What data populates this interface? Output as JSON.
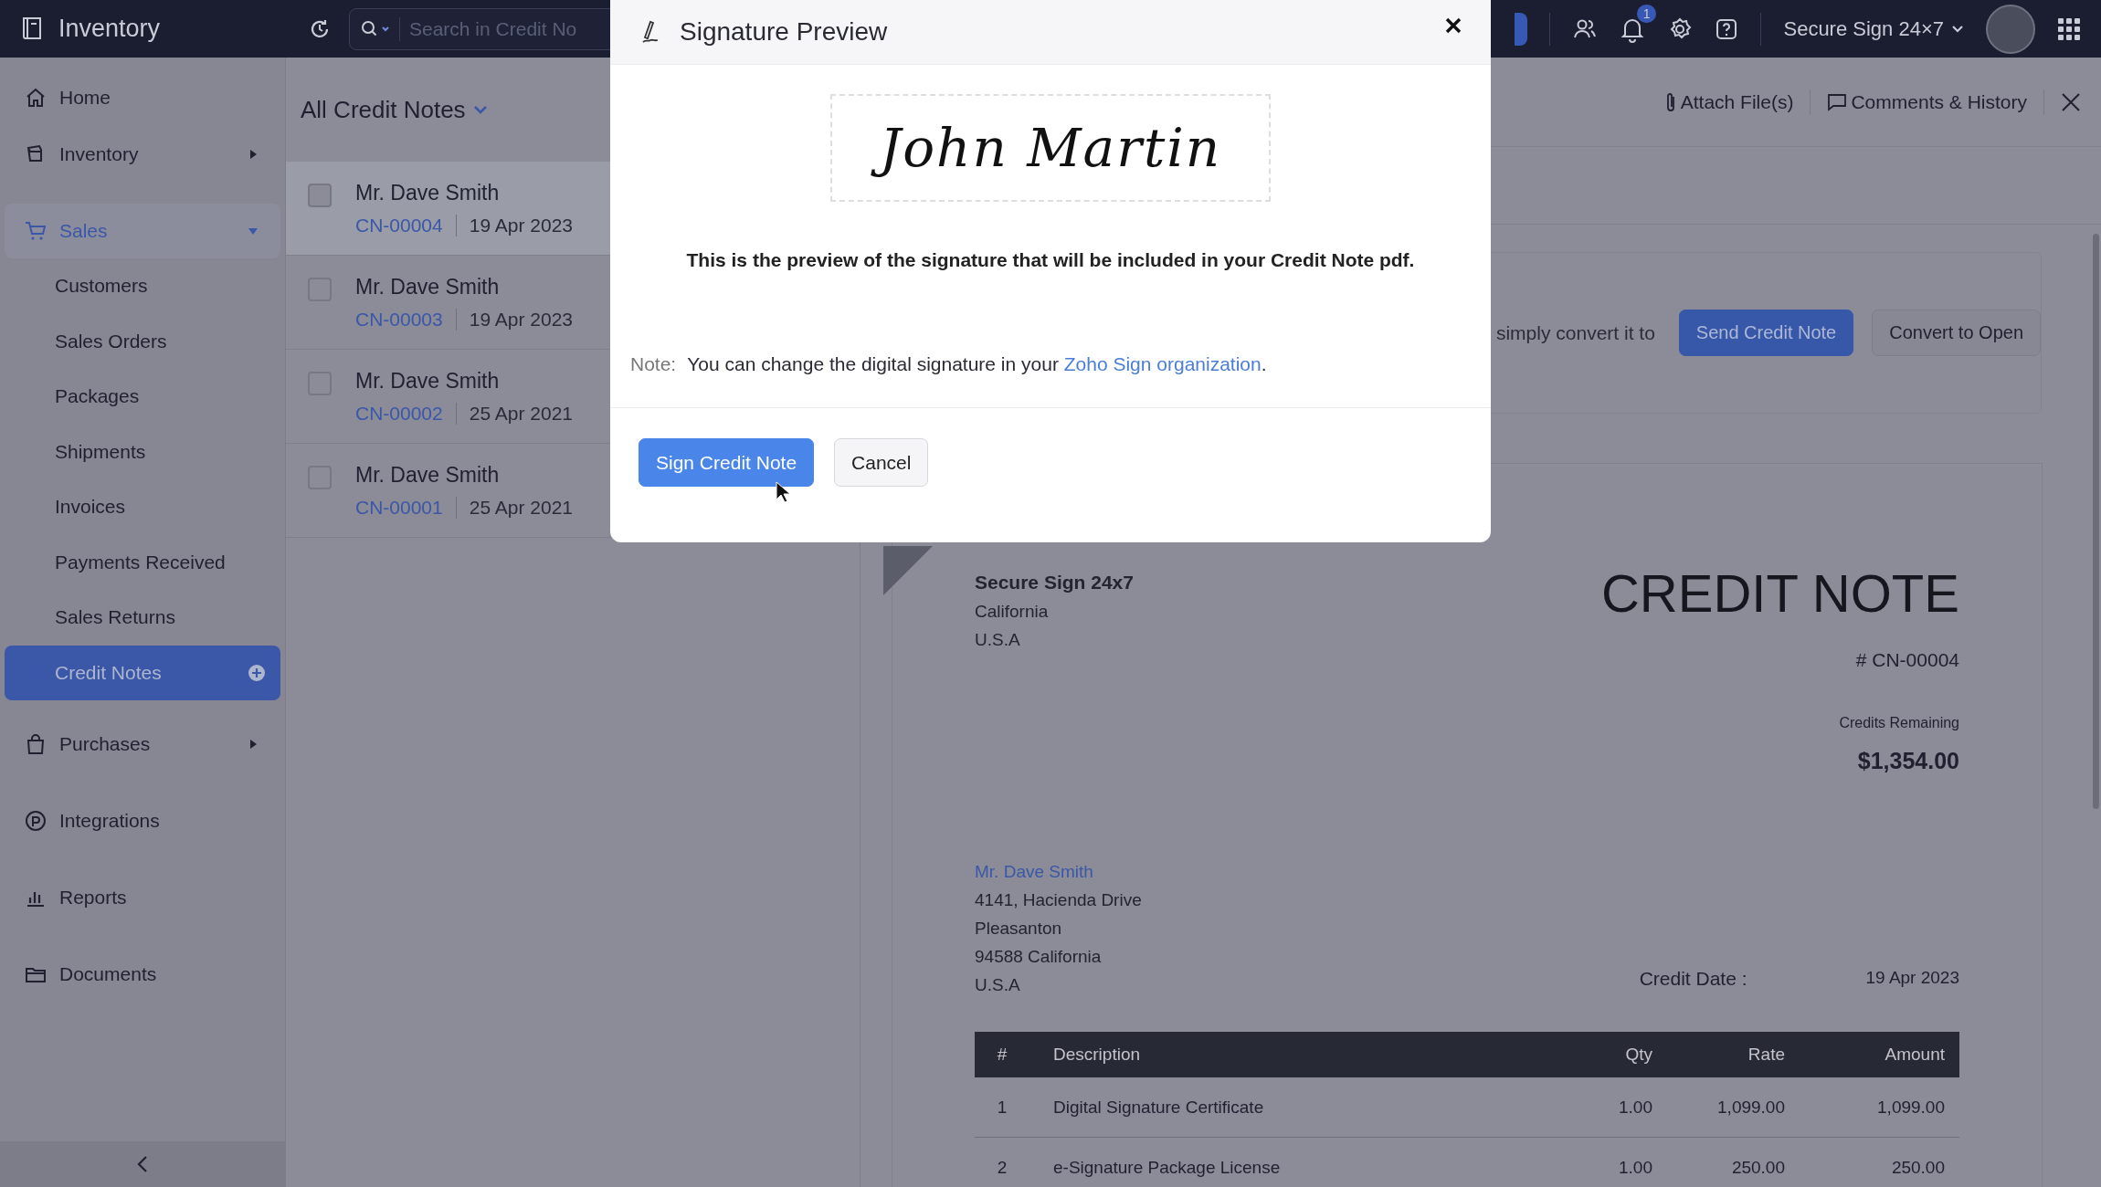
{
  "app": {
    "name": "Inventory"
  },
  "search": {
    "placeholder": "Search in Credit No"
  },
  "notifications": {
    "count": "1"
  },
  "organization": {
    "name": "Secure Sign 24×7"
  },
  "sidebar": {
    "items": [
      {
        "label": "Home",
        "kind": "link"
      },
      {
        "label": "Inventory",
        "kind": "group",
        "expanded": false
      },
      {
        "label": "Sales",
        "kind": "group",
        "expanded": true,
        "children": [
          {
            "label": "Customers",
            "selected": false
          },
          {
            "label": "Sales Orders",
            "selected": false
          },
          {
            "label": "Packages",
            "selected": false
          },
          {
            "label": "Shipments",
            "selected": false
          },
          {
            "label": "Invoices",
            "selected": false
          },
          {
            "label": "Payments Received",
            "selected": false
          },
          {
            "label": "Sales Returns",
            "selected": false
          },
          {
            "label": "Credit Notes",
            "selected": true
          }
        ]
      },
      {
        "label": "Purchases",
        "kind": "group",
        "expanded": false
      },
      {
        "label": "Integrations",
        "kind": "link"
      },
      {
        "label": "Reports",
        "kind": "link"
      },
      {
        "label": "Documents",
        "kind": "link"
      }
    ]
  },
  "list": {
    "title": "All Credit Notes",
    "rows": [
      {
        "customer": "Mr. Dave Smith",
        "number": "CN-00004",
        "date": "19 Apr 2023",
        "selected": true,
        "checked": false
      },
      {
        "customer": "Mr. Dave Smith",
        "number": "CN-00003",
        "date": "19 Apr 2023",
        "selected": false,
        "checked": false
      },
      {
        "customer": "Mr. Dave Smith",
        "number": "CN-00002",
        "date": "25 Apr 2021",
        "selected": false,
        "checked": false
      },
      {
        "customer": "Mr. Dave Smith",
        "number": "CN-00001",
        "date": "25 Apr 2021",
        "selected": false,
        "checked": false
      }
    ]
  },
  "detail": {
    "actions": [
      "Attach File(s)",
      "Comments & History"
    ],
    "banner": {
      "text": "simply convert it to",
      "buttons": [
        {
          "label": "Send Credit Note",
          "kind": "primary"
        },
        {
          "label": "Convert to Open",
          "kind": "secondary"
        }
      ]
    },
    "document": {
      "org_name": "Secure Sign 24x7",
      "org_address": [
        "California",
        "U.S.A"
      ],
      "title": "CREDIT NOTE",
      "number": "# CN-00004",
      "credits_label": "Credits Remaining",
      "credits_amount": "$1,354.00",
      "bill_to": "Mr. Dave Smith",
      "bill_address": [
        "4141, Hacienda Drive",
        "Pleasanton",
        "94588 California",
        "U.S.A"
      ],
      "date_label": "Credit Date :",
      "date_value": "19 Apr 2023",
      "table": {
        "columns": [
          "#",
          "Description",
          "Qty",
          "Rate",
          "Amount"
        ],
        "rows": [
          [
            "1",
            "Digital Signature Certificate",
            "1.00",
            "1,099.00",
            "1,099.00"
          ],
          [
            "2",
            "e-Signature Package License",
            "1.00",
            "250.00",
            "250.00"
          ]
        ]
      }
    }
  },
  "modal": {
    "title": "Signature Preview",
    "signature": "John Martin",
    "message": "This is the preview of the signature that will be included in your Credit Note pdf.",
    "note_label": "Note:",
    "note_before": "You can change the digital signature in your ",
    "note_link": "Zoho Sign organization",
    "note_after": ".",
    "buttons": [
      {
        "label": "Sign Credit Note",
        "kind": "primary"
      },
      {
        "label": "Cancel",
        "kind": "secondary"
      }
    ]
  }
}
